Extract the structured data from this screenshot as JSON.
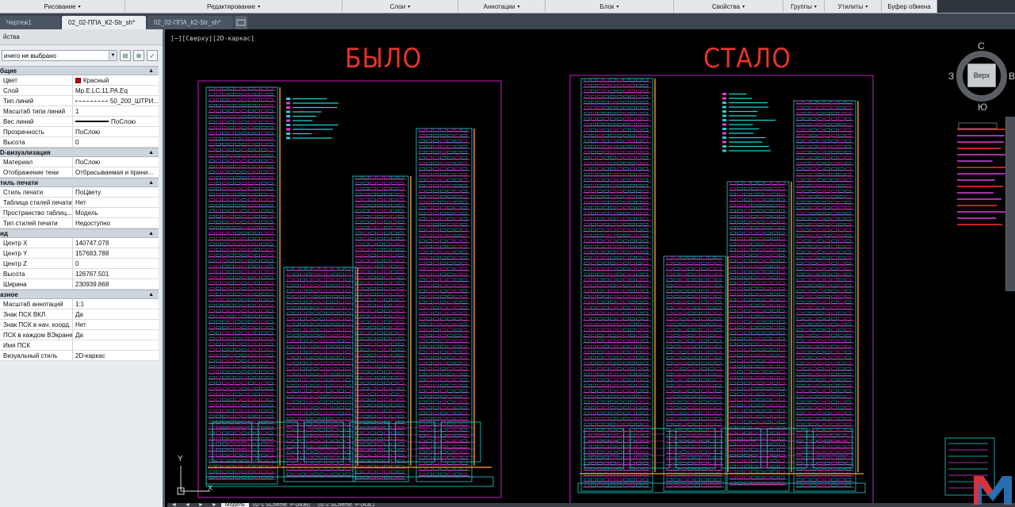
{
  "ribbon": {
    "groups": [
      {
        "label": "Рисование",
        "arrow": "▾"
      },
      {
        "label": "Редактирование",
        "arrow": "▾"
      },
      {
        "label": "Слои",
        "arrow": "▾"
      },
      {
        "label": "Аннотации",
        "arrow": "▾"
      },
      {
        "label": "Блок",
        "arrow": "▾"
      },
      {
        "label": "Свойства",
        "arrow": "▾"
      },
      {
        "label": "Группы",
        "arrow": "▾"
      },
      {
        "label": "Утилиты",
        "arrow": "▾"
      },
      {
        "label": "Буфер обмена",
        "arrow": ""
      }
    ]
  },
  "tabs": {
    "items": [
      "Чертеж1",
      "02_02-ППА_К2-Str_sh*",
      "02_02-ППА_К2-Str_sh*"
    ],
    "active_index": 1
  },
  "props": {
    "title": "йства",
    "selection": "ичего не выбрано",
    "sections": {
      "general": {
        "title": "бщие",
        "rows": [
          {
            "k": "Цвет",
            "v": "Красный"
          },
          {
            "k": "Слой",
            "v": "Mp.E.LC.11.PA.Eq"
          },
          {
            "k": "Тип линий",
            "v": "50_200_ШТРИ..."
          },
          {
            "k": "Масштаб типа линий",
            "v": "1"
          },
          {
            "k": "Вес линий",
            "v": "ПоСлою"
          },
          {
            "k": "Прозрачность",
            "v": "ПоСлою"
          },
          {
            "k": "Высота",
            "v": "0"
          }
        ]
      },
      "viz": {
        "title": "D-визуализация",
        "rows": [
          {
            "k": "Материал",
            "v": "ПоСлою"
          },
          {
            "k": "Отображение тени",
            "v": "Отбрасываемая и прини..."
          }
        ]
      },
      "plot": {
        "title": "тиль печати",
        "rows": [
          {
            "k": "Стиль печати",
            "v": "ПоЦвету"
          },
          {
            "k": "Таблица стилей печати",
            "v": "Нет"
          },
          {
            "k": "Пространство таблиц...",
            "v": "Модель"
          },
          {
            "k": "Тип стилей печати",
            "v": "Недоступно"
          }
        ]
      },
      "view": {
        "title": "ид",
        "rows": [
          {
            "k": "Центр X",
            "v": "140747.078"
          },
          {
            "k": "Центр Y",
            "v": "157683.788"
          },
          {
            "k": "Центр Z",
            "v": "0"
          },
          {
            "k": "Высота",
            "v": "126767.501"
          },
          {
            "k": "Ширина",
            "v": "230939.868"
          }
        ]
      },
      "misc": {
        "title": "азное",
        "rows": [
          {
            "k": "Масштаб аннотаций",
            "v": "1:1"
          },
          {
            "k": "Знак ПСК ВКЛ",
            "v": "Да"
          },
          {
            "k": "Знак ПСК в нач. коорд.",
            "v": "Нет"
          },
          {
            "k": "ПСК в каждом ВЭкране",
            "v": "Да"
          },
          {
            "k": "Имя ПСК",
            "v": ""
          },
          {
            "k": "Визуальный стиль",
            "v": "2D-каркас"
          }
        ]
      }
    }
  },
  "canvas": {
    "view_label": "[−][Сверху][2D-каркас]",
    "label_before": "БЫЛО",
    "label_after": "СТАЛО",
    "ucs_y": "Y",
    "ucs_x": "X"
  },
  "viewcube": {
    "north": "С",
    "south": "Ю",
    "west": "З",
    "east": "В",
    "face": "Верх"
  },
  "layout_tabs": [
    "◄",
    "◄",
    "►",
    "►",
    "Модель",
    "02-1 SCheme_P-(A0B)",
    "02-2 SCheme_P-(A3L)"
  ],
  "colors": {
    "frame": "#c020c0",
    "wire": "#e0891f",
    "cyan": "#1fd3d3",
    "magenta": "#e040e0",
    "red_label": "#e8332a"
  }
}
